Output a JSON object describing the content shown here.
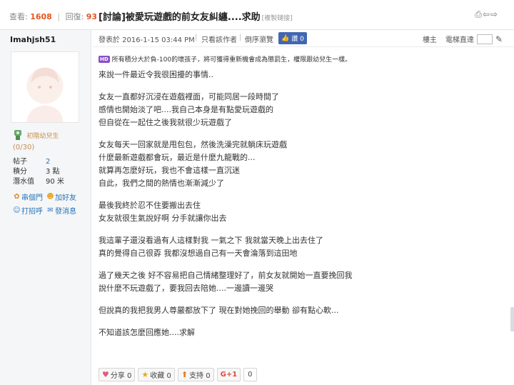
{
  "stats": {
    "views_label": "查看:",
    "views": "1608",
    "replies_label": "回復:",
    "replies": "93"
  },
  "thread": {
    "title": "[討論]被愛玩遊戲的前女友糾纏....求助",
    "permalink_label": "[複製鏈接]"
  },
  "top_icons": {
    "print": "print-icon",
    "prev": "prev-thread-icon",
    "next": "next-thread-icon"
  },
  "author": {
    "username": "Imahjsh51",
    "rank": "初階幼兒生",
    "rank_score": "(0/30)",
    "info": [
      {
        "key": "帖子",
        "value": "2"
      },
      {
        "key": "積分",
        "value": "3 點"
      },
      {
        "key": "潛水值",
        "value": "90 米"
      }
    ],
    "actions_row1": [
      {
        "icon": "flower-icon",
        "label": "串個門"
      },
      {
        "icon": "add-friend-icon",
        "label": "加好友"
      }
    ],
    "actions_row2": [
      {
        "icon": "greet-icon",
        "label": "打招呼"
      },
      {
        "icon": "message-icon",
        "label": "發消息"
      }
    ]
  },
  "post_meta": {
    "posted": "發表於 2016-1-15 03:44 PM",
    "author_only": "只看該作者",
    "reverse": "倒序瀏覽",
    "like_label": "讚 0",
    "floor": "樓主",
    "jump_label": "電梯直達"
  },
  "notice": {
    "badge": "HD",
    "text": "所有積分大於負-100的壞孩子，將可獲得重新機會成為懲罰生，權限跟幼兒生一樣。"
  },
  "post": {
    "lines": [
      "來說一件最近令我很困擾的事情..",
      "",
      "女友一直都好沉浸在遊戲裡面，可能同居一段時間了",
      "感情也開始淡了吧....我自己本身是有點愛玩遊戲的",
      "但自從在一起住之後我就很少玩遊戲了",
      "",
      "女友每天一回家就是甩包包，然後洗澡完就躺床玩遊戲",
      "什麼最新遊戲都會玩，最近是什麼九龍戰的...",
      "就算再怎麼好玩，我也不會這樣一直沉迷",
      "自此，我們之間的熱情也漸漸減少了",
      "",
      "最後我終於忍不住要搬出去住",
      "女友就很生氣說好啊 分手就讓你出去",
      "",
      "我這輩子還沒看過有人這樣對我 一氣之下 我就當天晚上出去住了",
      "真的覺得自己很孬 我都沒想過自己有一天會淪落到這田地",
      "",
      "過了幾天之後 好不容易把自己情緒整理好了，前女友就開始一直要挽回我",
      "說什麼不玩遊戲了，要我回去陪她....一邊讀一邊哭",
      "",
      "但說真的我把我男人尊嚴都放下了 現在對她挽回的舉動 卻有點心軟...",
      "",
      "不知道該怎麼回應她....求解"
    ]
  },
  "share_bar": {
    "share": "分享 0",
    "favorite": "收藏 0",
    "support": "支持 0",
    "gplus": "G+1",
    "gplus_count": "0"
  },
  "colors": {
    "accent_number": "#e45522",
    "link": "#2a73b8",
    "rank": "#c68f4d",
    "like": "#4267b2",
    "badge": "#8a4ec9"
  }
}
